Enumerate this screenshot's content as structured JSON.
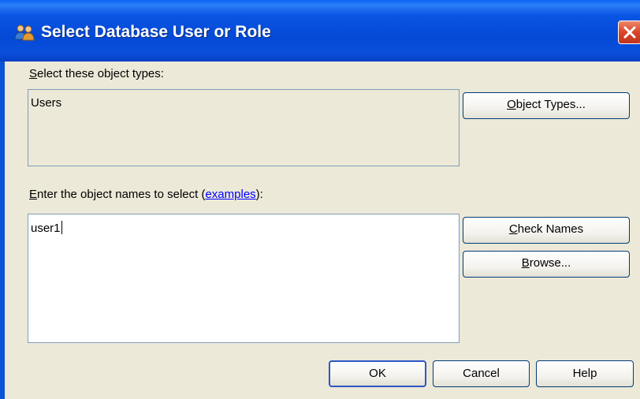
{
  "window": {
    "title": "Select Database User or Role",
    "icon": "users-icon",
    "close_icon": "close-icon"
  },
  "object_types": {
    "label_mnemonic": "S",
    "label_rest": "elect these object types:",
    "value": "Users",
    "button_mnemonic": "O",
    "button_rest": "bject Types..."
  },
  "object_names": {
    "label_mnemonic": "E",
    "label_rest": "nter the object names to select (",
    "link_text": "examples",
    "label_end": "):",
    "value": "user1"
  },
  "buttons": {
    "check_names_mnemonic": "C",
    "check_names_rest": "heck Names",
    "browse_mnemonic": "B",
    "browse_rest": "rowse...",
    "ok": "OK",
    "cancel": "Cancel",
    "help": "Help"
  },
  "colors": {
    "titlebar": "#0449d6",
    "dialog_bg": "#ece9d8",
    "close_button": "#d9442a",
    "link": "#0000ff"
  }
}
